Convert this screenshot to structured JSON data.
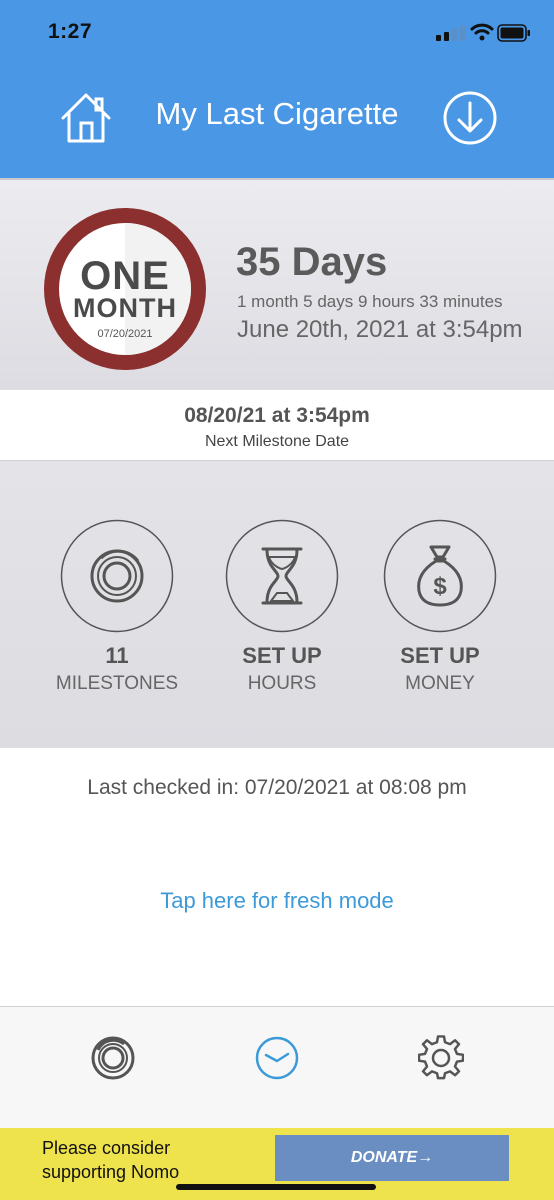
{
  "status_bar": {
    "time": "1:27"
  },
  "header": {
    "title": "My Last Cigarette",
    "icons": [
      "home-icon",
      "download-icon"
    ]
  },
  "badge": {
    "line1": "ONE",
    "line2": "MONTH",
    "date": "07/20/2021"
  },
  "summary": {
    "days": "35 Days",
    "duration": "1 month 5 days 9 hours 33 minutes",
    "quit_date": "June 20th, 2021 at 3:54pm"
  },
  "next_milestone": {
    "date": "08/20/21 at 3:54pm",
    "label": "Next Milestone Date"
  },
  "stats": [
    {
      "value": "11",
      "label": "MILESTONES",
      "icon": "milestone-rings-icon"
    },
    {
      "value": "SET UP",
      "label": "HOURS",
      "icon": "hourglass-icon"
    },
    {
      "value": "SET UP",
      "label": "MONEY",
      "icon": "money-bag-icon"
    }
  ],
  "last_checked": "Last checked in: 07/20/2021 at 08:08 pm",
  "fresh_mode_link": "Tap here for fresh mode",
  "tabs": [
    "milestones-tab-icon",
    "clock-tab-icon",
    "settings-tab-icon"
  ],
  "donate": {
    "message": "Please consider supporting Nomo",
    "button": "DONATE→"
  },
  "colors": {
    "header": "#4a97e5",
    "badge_ring": "#8b2f2f",
    "link": "#3d9ad9",
    "donate_bar": "#efe34d",
    "donate_button": "#6b8ec2"
  }
}
